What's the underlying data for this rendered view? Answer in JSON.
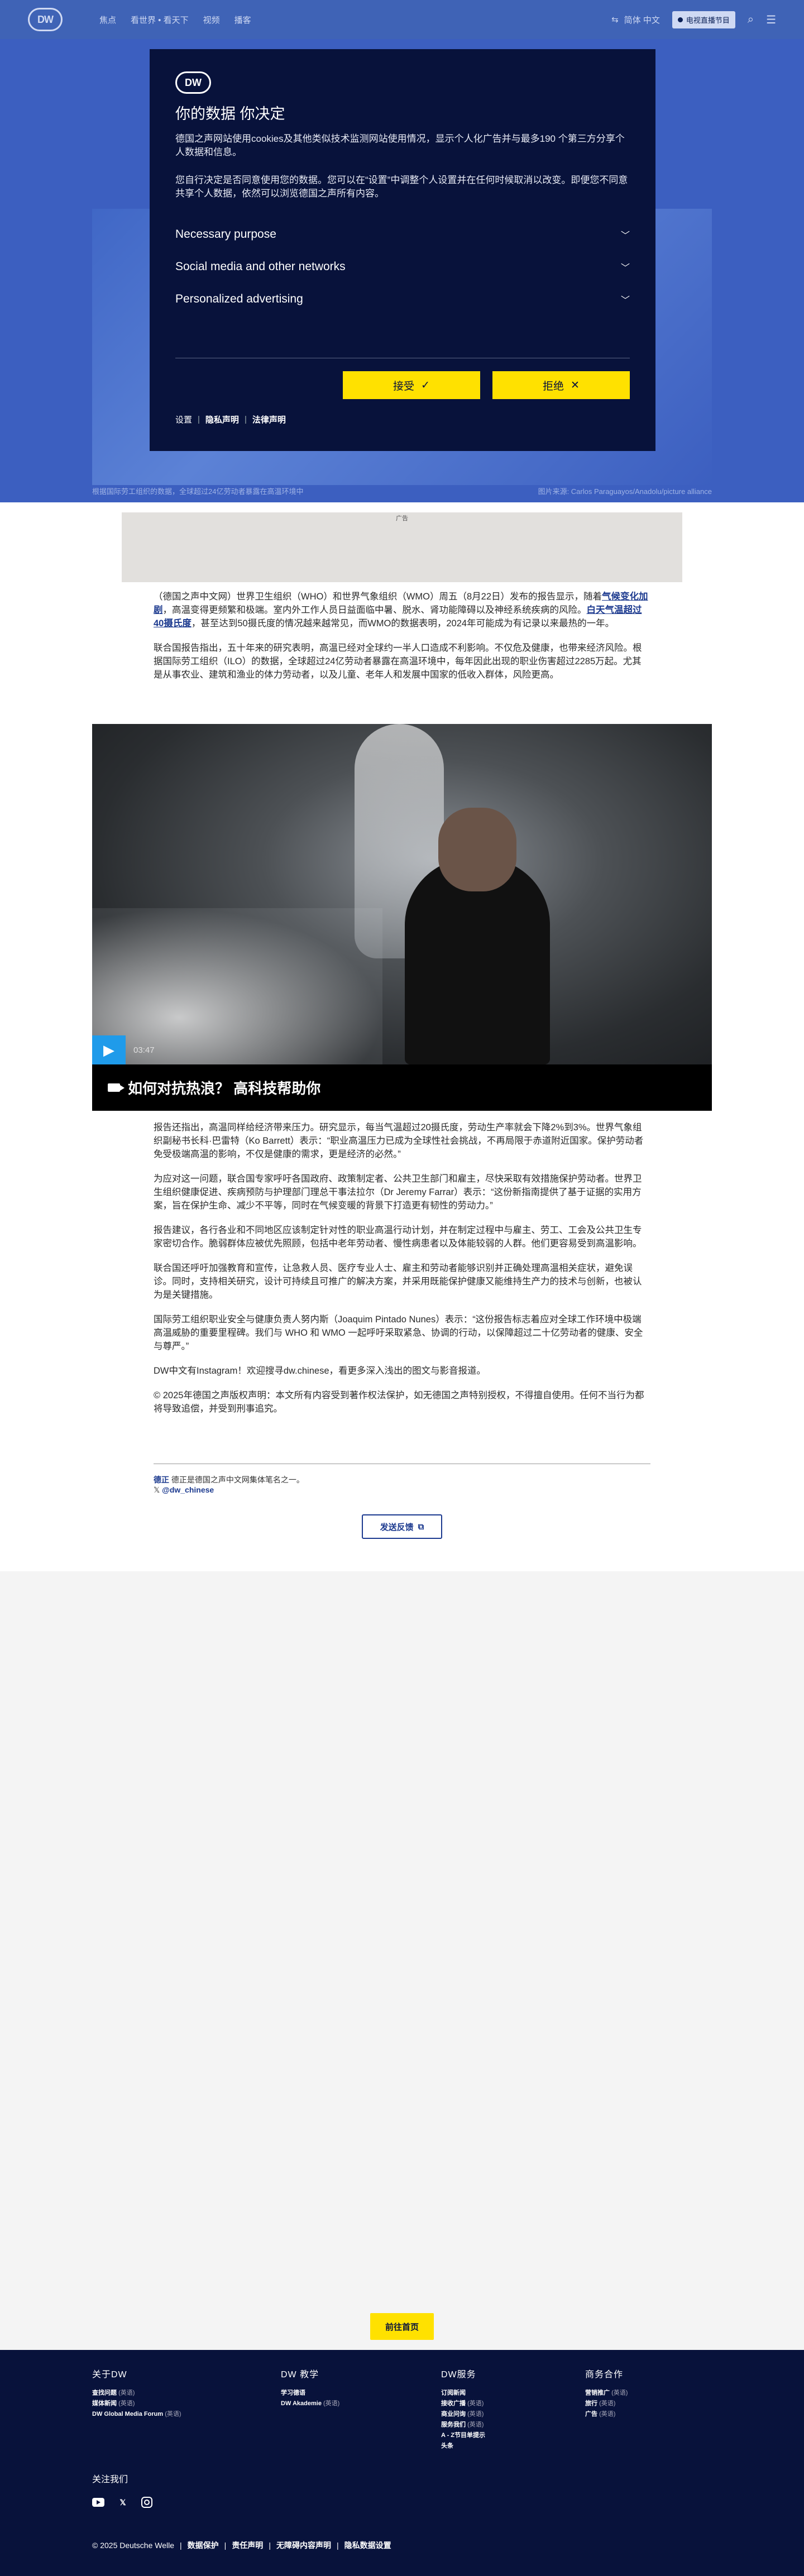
{
  "header": {
    "logo": "DW",
    "nav": [
      "焦点",
      "看世界 • 看天下",
      "视频",
      "播客"
    ],
    "language": "简体 中文",
    "live_label": "电视直播节目",
    "search_icon": "search-icon",
    "menu_icon": "menu-icon"
  },
  "hero": {
    "caption": "根据国际劳工组织的数据，全球超过24亿劳动者暴露在高温环境中",
    "credit": "图片来源: Carlos Paraguayos/Anadolu/picture alliance"
  },
  "cookie_modal": {
    "logo": "DW",
    "title": "你的数据 你决定",
    "para1": "德国之声网站使用cookies及其他类似技术监测网站使用情况，显示个人化广告并与最多190 个第三方分享个人数据和信息。",
    "para2": "您自行决定是否同意使用您的数据。您可以在“设置”中调整个人设置并在任何时候取消以改变。即便您不同意共享个人数据，依然可以浏览德国之声所有内容。",
    "sections": [
      "Necessary purpose",
      "Social media and other networks",
      "Personalized advertising"
    ],
    "accept_label": "接受",
    "reject_label": "拒绝",
    "links": [
      "设置",
      "隐私声明",
      "法律声明"
    ]
  },
  "ad": {
    "label": "广告"
  },
  "article": {
    "p1_pre": "（德国之声中文网）世界卫生组织（WHO）和世界气象组织（WMO）周五（8月22日）发布的报告显示，随着",
    "p1_link1": "气候变化加剧",
    "p1_mid": "，高温变得更频繁和极端。室内外工作人员日益面临中暑、脱水、肾功能障碍以及神经系统疾病的风险。",
    "p1_link2": "白天气温超过40摄氏度",
    "p1_post": "，甚至达到50摄氏度的情况越来越常见，而WMO的数据表明，2024年可能成为有记录以来最热的一年。",
    "p2": "联合国报告指出，五十年来的研究表明，高温已经对全球约一半人口造成不利影响。不仅危及健康，也带来经济风险。根据国际劳工组织（ILO）的数据，全球超过24亿劳动者暴露在高温环境中，每年因此出现的职业伤害超过2285万起。尤其是从事农业、建筑和渔业的体力劳动者，以及儿童、老年人和发展中国家的低收入群体，风险更高。",
    "p3": "报告还指出，高温同样给经济带来压力。研究显示，每当气温超过20摄氏度，劳动生产率就会下降2%到3%。世界气象组织副秘书长科·巴雷特（Ko Barrett）表示：“职业高温压力已成为全球性社会挑战，不再局限于赤道附近国家。保护劳动者免受极端高温的影响，不仅是健康的需求，更是经济的必然。”",
    "p4": "为应对这一问题，联合国专家呼吁各国政府、政策制定者、公共卫生部门和雇主，尽快采取有效措施保护劳动者。世界卫生组织健康促进、疾病预防与护理部门理总干事法拉尔（Dr Jeremy Farrar）表示：“这份新指南提供了基于证据的实用方案，旨在保护生命、减少不平等，同时在气候变暖的背景下打造更有韧性的劳动力。”",
    "p5": "报告建议，各行各业和不同地区应该制定针对性的职业高温行动计划，并在制定过程中与雇主、劳工、工会及公共卫生专家密切合作。脆弱群体应被优先照顾，包括中老年劳动者、慢性病患者以及体能较弱的人群。他们更容易受到高温影响。",
    "p6": "联合国还呼吁加强教育和宣传，让急救人员、医疗专业人士、雇主和劳动者能够识别并正确处理高温相关症状，避免误诊。同时，支持相关研究，设计可持续且可推广的解决方案，并采用既能保护健康又能维持生产力的技术与创新，也被认为是关键措施。",
    "p7": "国际劳工组织职业安全与健康负责人努内斯（Joaquim Pintado Nunes）表示：“这份报告标志着应对全球工作环境中极端高温威胁的重要里程碑。我们与 WHO 和 WMO 一起呼吁采取紧急、协调的行动，以保障超过二十亿劳动者的健康、安全与尊严。”",
    "p8": "DW中文有Instagram！欢迎搜寻dw.chinese，看更多深入浅出的图文与影音报道。",
    "p9": "© 2025年德国之声版权声明：本文所有内容受到著作权法保护，如无德国之声特别授权，不得擅自使用。任何不当行为都将导致追偿，并受到刑事追究。"
  },
  "video": {
    "duration": "03:47",
    "title": "如何对抗热浪？ 高科技帮助你"
  },
  "author": {
    "name": "德正",
    "desc": "德正是德国之声中文网集体笔名之一。",
    "handle": "@dw_chinese"
  },
  "feedback_label": "发送反馈",
  "back_home_label": "前往首页",
  "footer": {
    "col1_title": "关于DW",
    "col1_items": [
      {
        "label": "查找问题",
        "tag": "(英语)"
      },
      {
        "label": "媒体新闻",
        "tag": "(英语)"
      },
      {
        "label": "DW Global Media Forum",
        "tag": "(英语)"
      }
    ],
    "col2_title": "DW 教学",
    "col2_items": [
      {
        "label": "学习德语",
        "tag": ""
      },
      {
        "label": "DW Akademie",
        "tag": "(英语)"
      }
    ],
    "col3_title": "DW服务",
    "col3_items": [
      {
        "label": "订阅新闻",
        "tag": ""
      },
      {
        "label": "接收广播",
        "tag": "(英语)"
      },
      {
        "label": "商业问询",
        "tag": "(英语)"
      },
      {
        "label": "服务我们",
        "tag": "(英语)"
      },
      {
        "label": "A - Z节目单提示",
        "tag": ""
      },
      {
        "label": "头条",
        "tag": ""
      }
    ],
    "col4_title": "商务合作",
    "col4_items": [
      {
        "label": "营销推广",
        "tag": "(英语)"
      },
      {
        "label": "旅行",
        "tag": "(英语)"
      },
      {
        "label": "广告",
        "tag": "(英语)"
      }
    ],
    "follow_label": "关注我们",
    "copyright": "© 2025 Deutsche Welle",
    "links": [
      "数据保护",
      "责任声明",
      "无障碍内容声明",
      "隐私数据设置"
    ]
  }
}
